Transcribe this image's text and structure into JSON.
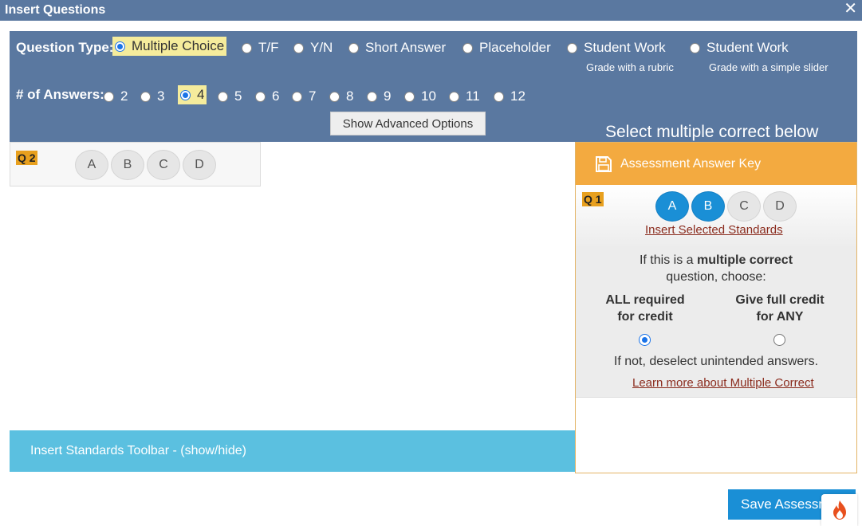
{
  "window": {
    "title": "Insert Questions",
    "close_glyph": "✕"
  },
  "question_type": {
    "label": "Question Type:",
    "options": [
      {
        "label": "Multiple Choice",
        "selected": true
      },
      {
        "label": "T/F",
        "selected": false
      },
      {
        "label": "Y/N",
        "selected": false
      },
      {
        "label": "Short Answer",
        "selected": false
      },
      {
        "label": "Placeholder",
        "selected": false
      },
      {
        "label": "Student Work",
        "note": "Grade with a rubric",
        "selected": false
      },
      {
        "label": "Student Work",
        "note": "Grade with a simple slider",
        "selected": false
      }
    ]
  },
  "num_answers": {
    "label": "# of Answers:",
    "options": [
      "2",
      "3",
      "4",
      "5",
      "6",
      "7",
      "8",
      "9",
      "10",
      "11",
      "12"
    ],
    "selected": "4"
  },
  "advanced_button": "Show Advanced Options",
  "select_multiple_hint": "Select multiple correct below",
  "q2": {
    "badge": "Q 2",
    "answers": [
      "A",
      "B",
      "C",
      "D"
    ]
  },
  "standards_toolbar": "Insert Standards Toolbar - (show/hide)",
  "answer_key": {
    "header": "Assessment Answer Key",
    "q1": {
      "badge": "Q 1",
      "answers": [
        {
          "letter": "A",
          "selected": true
        },
        {
          "letter": "B",
          "selected": true
        },
        {
          "letter": "C",
          "selected": false
        },
        {
          "letter": "D",
          "selected": false
        }
      ]
    },
    "insert_standards_link": "Insert Selected Standards",
    "prompt_prefix": "If this is a",
    "prompt_bold": "multiple correct",
    "prompt_suffix": "question, choose:",
    "option_all_line1": "ALL required",
    "option_all_line2": "for credit",
    "option_any_line1": "Give full credit",
    "option_any_line2": "for ANY",
    "selected_option": "all",
    "deselect_note": "If not, deselect unintended answers.",
    "learn_more_link": "Learn more about Multiple Correct"
  },
  "save_button": "Save Assessment",
  "colors": {
    "header_blue": "#5a78a0",
    "answer_key_orange": "#f3aa40",
    "toolbar_cyan": "#5bc0e0",
    "selected_answer_blue": "#1a8fd6",
    "badge_orange": "#e8a01e",
    "link_red": "#8b2c1e"
  },
  "icons": {
    "save": "floppy-disk-icon",
    "close": "close-icon",
    "logo": "flame-icon"
  }
}
